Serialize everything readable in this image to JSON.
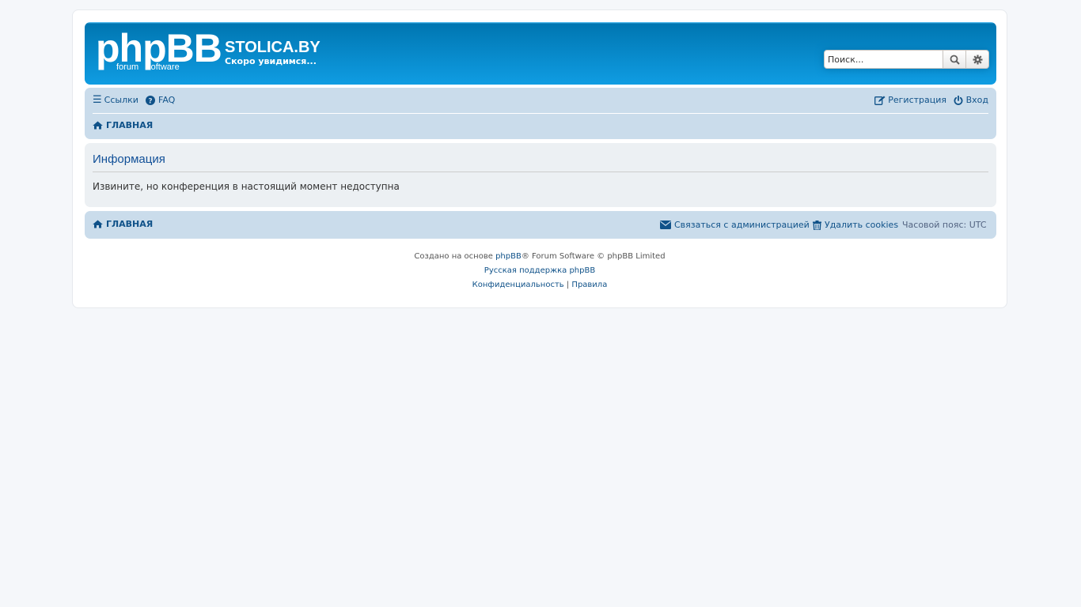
{
  "header": {
    "logo_main": "phpBB",
    "logo_sub1": "forum",
    "logo_sub2": "software",
    "site_title": "STOLICA.BY",
    "site_description": "Скоро увидимся..."
  },
  "search": {
    "placeholder": "Поиск...",
    "search_icon": "search-icon",
    "settings_icon": "gear-icon"
  },
  "nav": {
    "links_label": "Ссылки",
    "faq_label": "FAQ",
    "register_label": "Регистрация",
    "login_label": "Вход",
    "breadcrumb_home": "ГЛАВНАЯ"
  },
  "panel": {
    "title": "Информация",
    "message": "Извините, но конференция в настоящий момент недоступна"
  },
  "footer_nav": {
    "breadcrumb_home": "ГЛАВНАЯ",
    "contact_label": "Связаться с администрацией",
    "delete_cookies_label": "Удалить cookies",
    "timezone_label": "Часовой пояс:",
    "timezone_value": "UTC"
  },
  "copyright": {
    "line1_prefix": "Создано на основе ",
    "line1_link": "phpBB",
    "line1_suffix": "® Forum Software © phpBB Limited",
    "line2_link": "Русская поддержка phpBB",
    "privacy_link": "Конфиденциальность",
    "separator": "|",
    "rules_link": "Правила"
  },
  "colors": {
    "header_gradient_end": "#12a3eb",
    "nav_bg": "#cadceb",
    "link": "#105289"
  }
}
